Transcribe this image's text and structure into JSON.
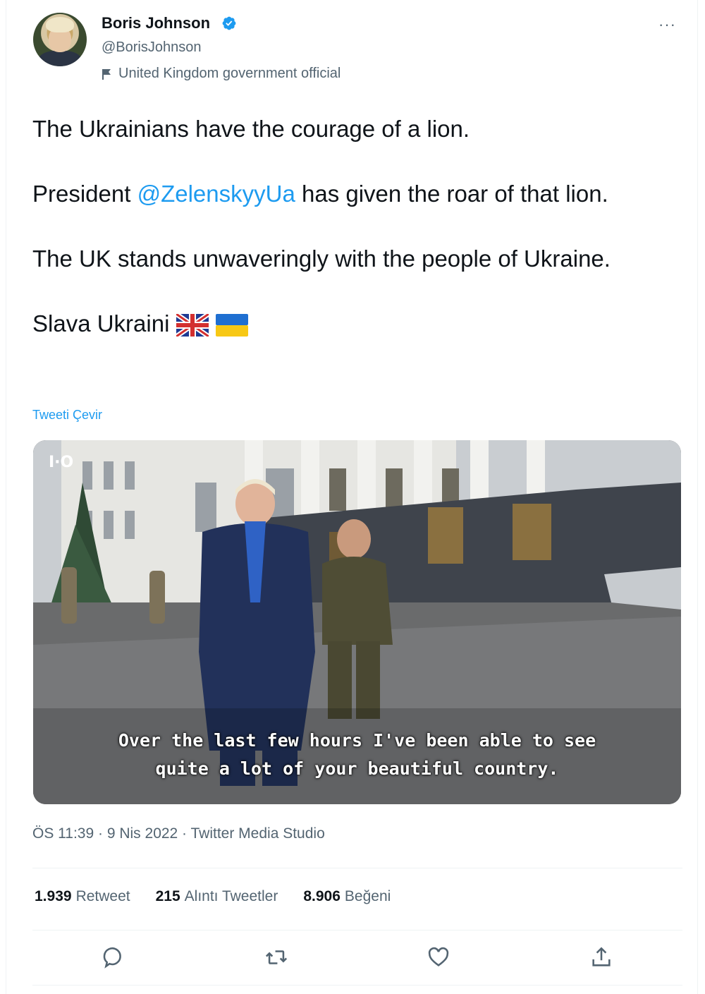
{
  "author": {
    "name": "Boris Johnson",
    "handle": "@BorisJohnson",
    "label": "United Kingdom government official"
  },
  "tweet": {
    "line1": "The Ukrainians have the courage of a lion.",
    "line2_pre": "President ",
    "line2_mention": "@ZelenskyyUa",
    "line2_post": " has given the roar of that lion.",
    "line3": "The UK stands unwaveringly with the people of Ukraine.",
    "line4": "Slava Ukraini",
    "translate_label": "Tweeti Çevir"
  },
  "media": {
    "caption_line1": "Over the last few hours I've been able to see",
    "caption_line2": "quite a lot of your beautiful country."
  },
  "meta": {
    "timestamp": "ÖS 11:39 · 9 Nis 2022 · Twitter Media Studio"
  },
  "stats": {
    "retweets_count": "1.939",
    "retweets_label": "Retweet",
    "quotes_count": "215",
    "quotes_label": "Alıntı Tweetler",
    "likes_count": "8.906",
    "likes_label": "Beğeni"
  },
  "colors": {
    "accent": "#1d9bf0",
    "text": "#0f1419",
    "secondary": "#536471"
  },
  "icons": [
    "verified-badge-icon",
    "government-flag-icon",
    "more-options-icon",
    "reply-icon",
    "retweet-icon",
    "like-icon",
    "share-icon",
    "uk-flag-emoji",
    "ukraine-flag-emoji"
  ]
}
